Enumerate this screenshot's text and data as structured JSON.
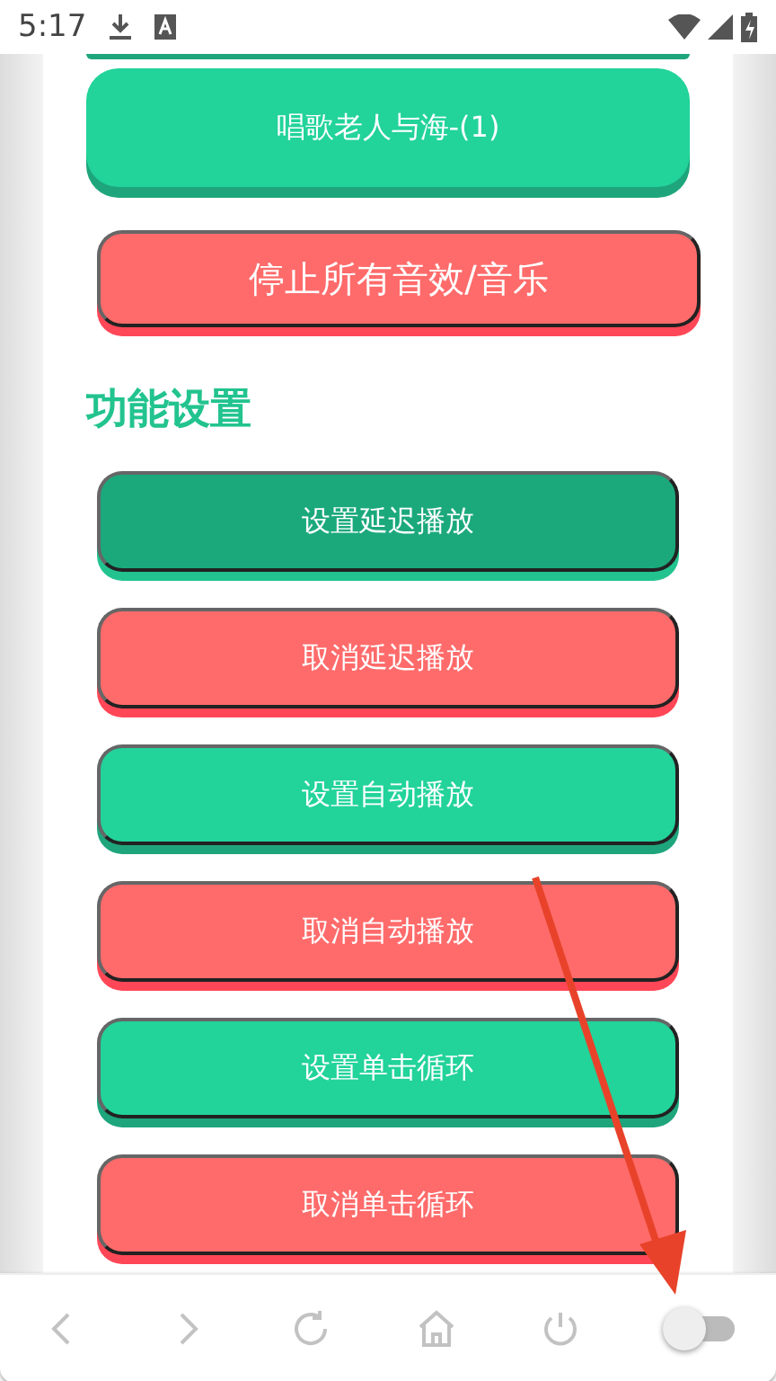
{
  "status_bar": {
    "time": "5:17"
  },
  "play_button": {
    "label": "唱歌老人与海-(1)"
  },
  "stop_button": {
    "label": "停止所有音效/音乐"
  },
  "section_title": "功能设置",
  "settings_buttons": [
    {
      "label": "设置延迟播放",
      "kind": "set",
      "selected": true
    },
    {
      "label": "取消延迟播放",
      "kind": "cancel",
      "selected": false
    },
    {
      "label": "设置自动播放",
      "kind": "set",
      "selected": false
    },
    {
      "label": "取消自动播放",
      "kind": "cancel",
      "selected": false
    },
    {
      "label": "设置单击循环",
      "kind": "set",
      "selected": false
    },
    {
      "label": "取消单击循环",
      "kind": "cancel",
      "selected": false
    }
  ],
  "bottom_bar": {
    "toggle": {
      "on": false
    }
  }
}
